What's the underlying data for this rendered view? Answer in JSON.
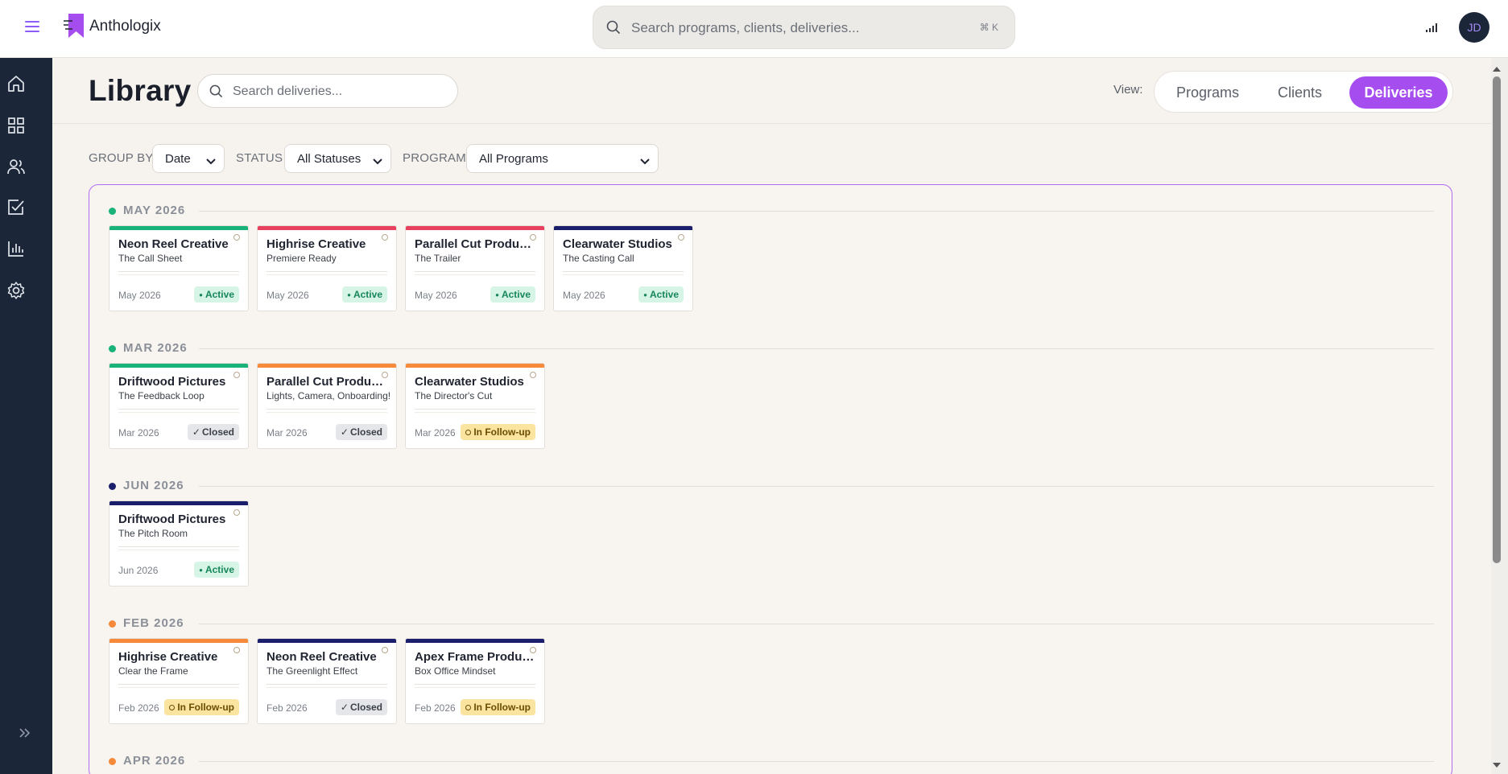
{
  "app": {
    "brand": "Anthologix",
    "global_search_placeholder": "Search programs, clients, deliveries...",
    "global_search_shortcut": "⌘ K",
    "user_initials": "JD",
    "accent_color": "#a64df0"
  },
  "sidebar": {
    "items": [
      {
        "icon": "home-icon"
      },
      {
        "icon": "grid-icon"
      },
      {
        "icon": "users-icon"
      },
      {
        "icon": "checkbox-icon"
      },
      {
        "icon": "bar-chart-icon"
      },
      {
        "icon": "gear-icon"
      }
    ],
    "expand_icon": "double-chevron-right-icon"
  },
  "page": {
    "title": "Library",
    "search_placeholder": "Search deliveries...",
    "view_label": "View:",
    "views": [
      "Programs",
      "Clients",
      "Deliveries"
    ],
    "active_view": "Deliveries"
  },
  "filters": {
    "group_by_label": "GROUP BY",
    "group_by_value": "Date",
    "status_label": "STATUS",
    "status_value": "All Statuses",
    "program_label": "PROGRAM",
    "program_value": "All Programs"
  },
  "status_colors": {
    "active": "#19b37a",
    "closed": "#1b1f6b",
    "followup": "#f68a3a",
    "attention": "#e8415f"
  },
  "groups": [
    {
      "label": "MAY 2026",
      "dot_color": "#19b37a",
      "cards": [
        {
          "client": "Neon Reel Creative",
          "program": "The Call Sheet",
          "date": "May 2026",
          "status": "Active",
          "status_type": "active",
          "bar_color": "#19b37a"
        },
        {
          "client": "Highrise Creative",
          "program": "Premiere Ready",
          "date": "May 2026",
          "status": "Active",
          "status_type": "active",
          "bar_color": "#e8415f"
        },
        {
          "client": "Parallel Cut Productions",
          "program": "The Trailer",
          "date": "May 2026",
          "status": "Active",
          "status_type": "active",
          "bar_color": "#e8415f"
        },
        {
          "client": "Clearwater Studios",
          "program": "The Casting Call",
          "date": "May 2026",
          "status": "Active",
          "status_type": "active",
          "bar_color": "#1b1f6b"
        }
      ]
    },
    {
      "label": "MAR 2026",
      "dot_color": "#19b37a",
      "cards": [
        {
          "client": "Driftwood Pictures",
          "program": "The Feedback Loop",
          "date": "Mar 2026",
          "status": "Closed",
          "status_type": "closed",
          "bar_color": "#19b37a"
        },
        {
          "client": "Parallel Cut Productions",
          "program": "Lights, Camera, Onboarding!",
          "date": "Mar 2026",
          "status": "Closed",
          "status_type": "closed",
          "bar_color": "#f68a3a"
        },
        {
          "client": "Clearwater Studios",
          "program": "The Director's Cut",
          "date": "Mar 2026",
          "status": "In Follow-up",
          "status_type": "followup",
          "bar_color": "#f68a3a"
        }
      ]
    },
    {
      "label": "JUN 2026",
      "dot_color": "#1b1f6b",
      "cards": [
        {
          "client": "Driftwood Pictures",
          "program": "The Pitch Room",
          "date": "Jun 2026",
          "status": "Active",
          "status_type": "active",
          "bar_color": "#1b1f6b"
        }
      ]
    },
    {
      "label": "FEB 2026",
      "dot_color": "#f68a3a",
      "cards": [
        {
          "client": "Highrise Creative",
          "program": "Clear the Frame",
          "date": "Feb 2026",
          "status": "In Follow-up",
          "status_type": "followup",
          "bar_color": "#f68a3a"
        },
        {
          "client": "Neon Reel Creative",
          "program": "The Greenlight Effect",
          "date": "Feb 2026",
          "status": "Closed",
          "status_type": "closed",
          "bar_color": "#1b1f6b"
        },
        {
          "client": "Apex Frame Productions",
          "program": "Box Office Mindset",
          "date": "Feb 2026",
          "status": "In Follow-up",
          "status_type": "followup",
          "bar_color": "#1b1f6b"
        }
      ]
    },
    {
      "label": "APR 2026",
      "dot_color": "#f68a3a",
      "cards": []
    }
  ]
}
